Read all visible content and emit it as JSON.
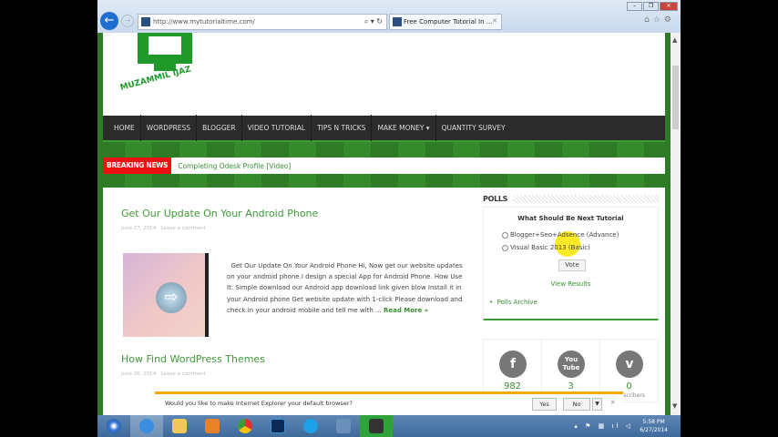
{
  "browser": {
    "url": "http://www.mytutorialtime.com/",
    "tab_title": "Free Computer Tutorial In ...",
    "controls": {
      "search": "⌕ ▾ ↻"
    }
  },
  "logo": {
    "text": "MUZAMMIL IJAZ"
  },
  "nav": {
    "items": [
      "HOME",
      "WORDPRESS",
      "BLOGGER",
      "VIDEO TUTORIAL",
      "TIPS N TRICKS",
      "MAKE MONEY ▾",
      "QUANTITY SURVEY"
    ]
  },
  "breaking": {
    "label": "BREAKING NEWS",
    "text": "Completing Odesk Profile [Video]"
  },
  "posts": [
    {
      "title": "Get Our Update On Your Android Phone",
      "date": "June 27, 2014",
      "comment": "Leave a comment",
      "excerpt": "Get Our Update On Your Android Phone Hi, Now get our website updates on your android phone.I design a special  App for Android Phone. How Use It: Simple download our Android app download link given blow Install it in your Android phone Get website update with 1-click Please download and check in your android mobile and tell me with ...",
      "read_more": "Read More »"
    },
    {
      "title": "How Find WordPress Themes",
      "date": "June 26, 2014",
      "comment": "Leave a comment"
    }
  ],
  "polls": {
    "heading": "POLLS",
    "question": "What Should Be Next Tutorial",
    "options": [
      "Blogger+Seo+Adsence (Advance)",
      "Visual Basic 2013 (Basic)"
    ],
    "vote": "Vote",
    "view_results": "View Results",
    "archive": "Polls Archive"
  },
  "social": [
    {
      "icon": "f",
      "count": "982"
    },
    {
      "icon": "You Tube",
      "count": "3"
    },
    {
      "icon": "v",
      "count": "0",
      "label": "Subscribers"
    }
  ],
  "notification": {
    "text": "Would you like to make Internet Explorer your default browser?",
    "yes": "Yes",
    "no": "No"
  },
  "taskbar": {
    "time": "5:58 PM",
    "date": "6/27/2014"
  }
}
